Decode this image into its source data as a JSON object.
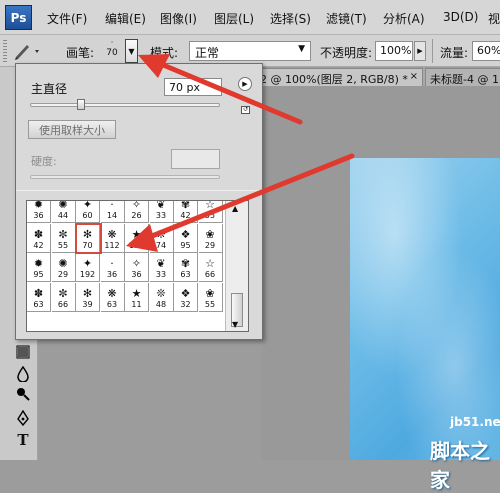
{
  "menubar": {
    "logo": "Ps",
    "items": [
      "文件(F)",
      "编辑(E)",
      "图像(I)",
      "图层(L)",
      "选择(S)",
      "滤镜(T)",
      "分析(A)",
      "3D(D)",
      "视"
    ]
  },
  "options": {
    "brush_label": "画笔:",
    "brush_size": "70",
    "mode_label": "模式:",
    "mode_value": "正常",
    "opacity_label": "不透明度:",
    "opacity_value": "100%",
    "flow_label": "流量:",
    "flow_value": "60%"
  },
  "tabs": [
    "2 @ 100%(图层 2, RGB/8) *",
    "未标题-4 @ 1"
  ],
  "brush_panel": {
    "diameter_label": "主直径",
    "diameter_value": "70 px",
    "diameter_level": 0.27,
    "sample_button": "使用取样大小",
    "hardness_label": "硬度:",
    "grid": {
      "rows": [
        [
          "36",
          "44",
          "60",
          "14",
          "26",
          "33",
          "42",
          "55"
        ],
        [
          "42",
          "55",
          "70",
          "112",
          "134",
          "74",
          "95",
          "29"
        ],
        [
          "95",
          "29",
          "192",
          "36",
          "36",
          "33",
          "63",
          "66"
        ],
        [
          "63",
          "66",
          "39",
          "63",
          "11",
          "48",
          "32",
          "55"
        ]
      ],
      "selected_size": "70"
    }
  },
  "watermark": {
    "url": "jb51.net",
    "name": "脚本之家"
  },
  "colors": {
    "highlight": "#d64a3d",
    "canvas_blue": "#6fbde8"
  }
}
